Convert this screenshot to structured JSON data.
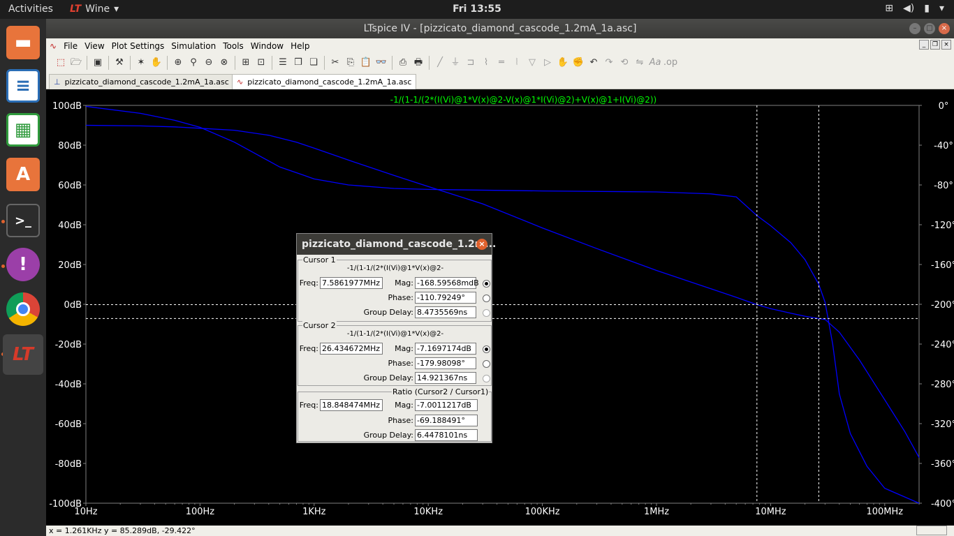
{
  "topbar": {
    "activities": "Activities",
    "app_name": "Wine",
    "clock": "Fri 13:55"
  },
  "dock": {
    "items": [
      "files",
      "writer",
      "calc",
      "software",
      "terminal",
      "podcast",
      "chrome",
      "ltspice"
    ]
  },
  "window": {
    "title": "LTspice IV - [pizzicato_diamond_cascode_1.2mA_1a.asc]"
  },
  "menu": {
    "items": [
      "File",
      "View",
      "Plot Settings",
      "Simulation",
      "Tools",
      "Window",
      "Help"
    ]
  },
  "tabs": [
    {
      "label": "pizzicato_diamond_cascode_1.2mA_1a.asc"
    },
    {
      "label": "pizzicato_diamond_cascode_1.2mA_1a.asc"
    }
  ],
  "plot": {
    "trace_label": "-1/(1-1/(2*(I(Vi)@1*V(x)@2-V(x)@1*I(Vi)@2)+V(x)@1+I(Vi)@2))",
    "colors": {
      "background": "#000000",
      "grid": "#ffffff",
      "trace": "#0000ff",
      "label": "#00ff00",
      "axis_text": "#ffffff"
    }
  },
  "chart_data": {
    "type": "line",
    "xscale": "log",
    "xlim": [
      10,
      200000000
    ],
    "ylim": [
      -100,
      100
    ],
    "y2lim": [
      -400,
      0
    ],
    "x_ticks": [
      "10Hz",
      "100Hz",
      "1KHz",
      "10KHz",
      "100KHz",
      "1MHz",
      "10MHz",
      "100MHz"
    ],
    "y_ticks": [
      "100dB",
      "80dB",
      "60dB",
      "40dB",
      "20dB",
      "0dB",
      "-20dB",
      "-40dB",
      "-60dB",
      "-80dB",
      "-100dB"
    ],
    "y2_ticks": [
      "0°",
      "-40°",
      "-80°",
      "-120°",
      "-160°",
      "-200°",
      "-240°",
      "-280°",
      "-320°",
      "-360°",
      "-400°"
    ],
    "series": [
      {
        "name": "magnitude",
        "x": [
          10,
          30,
          60,
          100,
          200,
          400,
          700,
          1000,
          2000,
          5000,
          10000,
          30000,
          100000,
          300000,
          1000000,
          3000000,
          5000000,
          7586197,
          10000000,
          15000000,
          20000000,
          26434672,
          30000000,
          40000000,
          60000000,
          100000000,
          150000000,
          200000000
        ],
        "y": [
          90,
          89.7,
          89.2,
          88.5,
          87.5,
          85,
          81.5,
          78.5,
          72.5,
          64.8,
          59.2,
          50.5,
          38.4,
          28,
          17,
          7.8,
          3.5,
          -0.17,
          -2.2,
          -4.5,
          -6,
          -7.17,
          -7.6,
          -14,
          -28,
          -48,
          -64,
          -77
        ]
      },
      {
        "name": "phase",
        "x": [
          10,
          30,
          60,
          100,
          200,
          300,
          500,
          800,
          1000,
          2000,
          5000,
          10000,
          100000,
          1000000,
          3000000,
          5000000,
          7586197,
          10000000,
          15000000,
          20000000,
          26434672,
          30000000,
          35000000,
          40000000,
          50000000,
          70000000,
          100000000,
          200000000
        ],
        "y": [
          -1,
          -8,
          -15,
          -22,
          -37,
          -48,
          -62,
          -70,
          -74,
          -80,
          -83.5,
          -84.5,
          -86,
          -87,
          -89,
          -92,
          -110.8,
          -121,
          -138,
          -155,
          -180,
          -198,
          -240,
          -290,
          -330,
          -363,
          -385,
          -400
        ]
      }
    ],
    "cursors": [
      {
        "freq_hz": 7586197,
        "mag_db": -0.17,
        "phase_deg": -110.8
      },
      {
        "freq_hz": 26434672,
        "mag_db": -7.17,
        "phase_deg": -180
      }
    ]
  },
  "dialog": {
    "title": "pizzicato_diamond_cascode_1.2m...",
    "cursor1": {
      "label": "Cursor 1",
      "expr": "-1/(1-1/(2*(I(Vi)@1*V(x)@2-",
      "freq_label": "Freq:",
      "freq": "7.5861977MHz",
      "mag_label": "Mag:",
      "mag": "-168.59568mdB",
      "phase_label": "Phase:",
      "phase": "-110.79249°",
      "gd_label": "Group Delay:",
      "gd": "8.4735569ns"
    },
    "cursor2": {
      "label": "Cursor 2",
      "expr": "-1/(1-1/(2*(I(Vi)@1*V(x)@2-",
      "freq_label": "Freq:",
      "freq": "26.434672MHz",
      "mag_label": "Mag:",
      "mag": "-7.1697174dB",
      "phase_label": "Phase:",
      "phase": "-179.98098°",
      "gd_label": "Group Delay:",
      "gd": "14.921367ns"
    },
    "ratio": {
      "label": "Ratio (Cursor2 / Cursor1)",
      "freq_label": "Freq:",
      "freq": "18.848474MHz",
      "mag_label": "Mag:",
      "mag": "-7.0011217dB",
      "phase_label": "Phase:",
      "phase": "-69.188491°",
      "gd_label": "Group Delay:",
      "gd": "6.4478101ns"
    }
  },
  "status": {
    "text": "x = 1.261KHz    y = 85.289dB, -29.422°"
  }
}
